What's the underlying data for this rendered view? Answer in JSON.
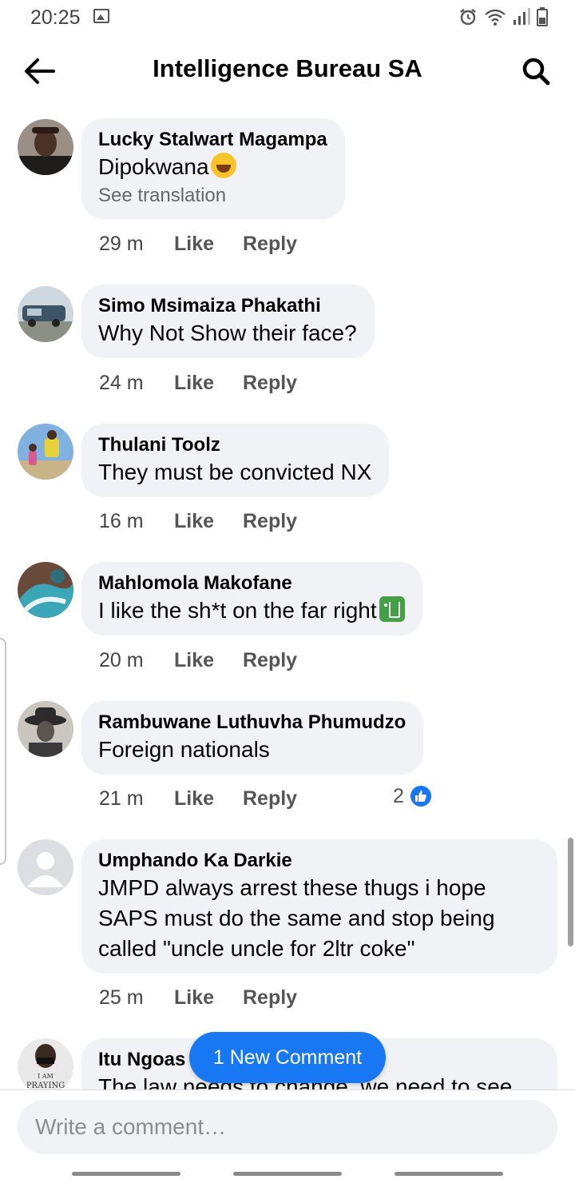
{
  "status": {
    "time": "20:25"
  },
  "header": {
    "title": "Intelligence Bureau SA"
  },
  "comments": [
    {
      "author": "Lucky Stalwart Magampa",
      "text": "Dipokwana",
      "translation": "See translation",
      "time": "29 m",
      "like": "Like",
      "reply": "Reply"
    },
    {
      "author": "Simo Msimaiza Phakathi",
      "text": "Why Not Show their face?",
      "time": "24 m",
      "like": "Like",
      "reply": "Reply"
    },
    {
      "author": "Thulani Toolz",
      "text": "They must be convicted NX",
      "time": "16 m",
      "like": "Like",
      "reply": "Reply"
    },
    {
      "author": "Mahlomola Makofane",
      "text": "I like the sh*t on the far right",
      "time": "20 m",
      "like": "Like",
      "reply": "Reply"
    },
    {
      "author": "Rambuwane Luthuvha Phumudzo",
      "text": "Foreign nationals",
      "time": "21 m",
      "like": "Like",
      "reply": "Reply",
      "reaction_count": "2"
    },
    {
      "author": "Umphando Ka Darkie",
      "lines": [
        "JMPD always arrest these thugs i hope",
        "SAPS must do the same and stop being",
        "called \"uncle uncle for 2ltr coke\""
      ],
      "time": "25 m",
      "like": "Like",
      "reply": "Reply"
    },
    {
      "author": "Itu Ngoas",
      "text": "The law needs to change, we need to see",
      "avatar_text": [
        "I AM",
        "PRAYING"
      ]
    }
  ],
  "new_comment": "1 New Comment",
  "composer": {
    "placeholder": "Write a comment…"
  },
  "colors": {
    "accent": "#1877f2",
    "bubble": "#f0f2f5",
    "secondary_text": "#65676b"
  }
}
